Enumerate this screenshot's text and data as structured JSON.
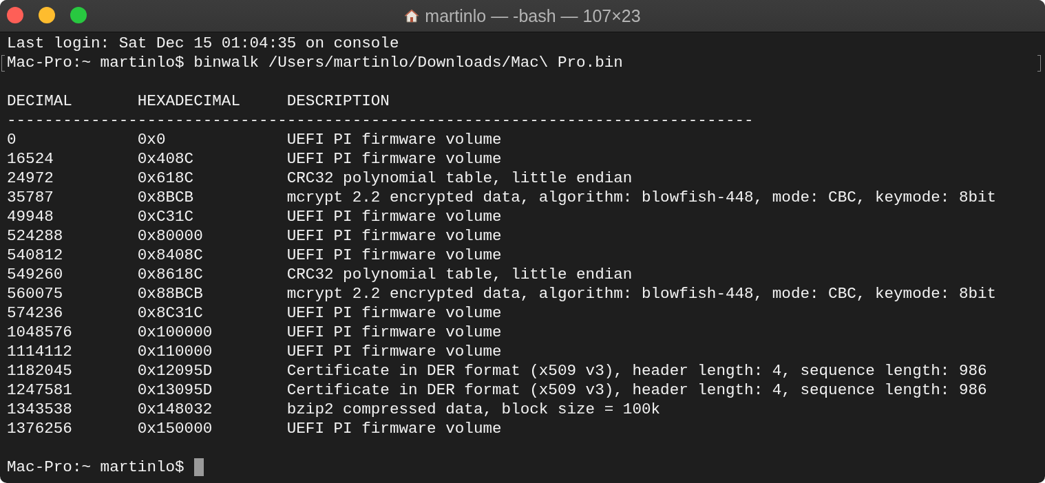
{
  "window": {
    "title": "martinlo — -bash — 107×23"
  },
  "lines": [
    {
      "kind": "text",
      "text": "Last login: Sat Dec 15 01:04:35 on console",
      "marked": false
    },
    {
      "kind": "text",
      "text": "Mac-Pro:~ martinlo$ binwalk /Users/martinlo/Downloads/Mac\\ Pro.bin",
      "marked": true
    },
    {
      "kind": "blank"
    },
    {
      "kind": "row",
      "cells": [
        "DECIMAL",
        "HEXADECIMAL",
        "DESCRIPTION"
      ]
    },
    {
      "kind": "text",
      "text": "--------------------------------------------------------------------------------",
      "marked": false
    },
    {
      "kind": "row",
      "cells": [
        "0",
        "0x0",
        "UEFI PI firmware volume"
      ]
    },
    {
      "kind": "row",
      "cells": [
        "16524",
        "0x408C",
        "UEFI PI firmware volume"
      ]
    },
    {
      "kind": "row",
      "cells": [
        "24972",
        "0x618C",
        "CRC32 polynomial table, little endian"
      ]
    },
    {
      "kind": "row",
      "cells": [
        "35787",
        "0x8BCB",
        "mcrypt 2.2 encrypted data, algorithm: blowfish-448, mode: CBC, keymode: 8bit"
      ]
    },
    {
      "kind": "row",
      "cells": [
        "49948",
        "0xC31C",
        "UEFI PI firmware volume"
      ]
    },
    {
      "kind": "row",
      "cells": [
        "524288",
        "0x80000",
        "UEFI PI firmware volume"
      ]
    },
    {
      "kind": "row",
      "cells": [
        "540812",
        "0x8408C",
        "UEFI PI firmware volume"
      ]
    },
    {
      "kind": "row",
      "cells": [
        "549260",
        "0x8618C",
        "CRC32 polynomial table, little endian"
      ]
    },
    {
      "kind": "row",
      "cells": [
        "560075",
        "0x88BCB",
        "mcrypt 2.2 encrypted data, algorithm: blowfish-448, mode: CBC, keymode: 8bit"
      ]
    },
    {
      "kind": "row",
      "cells": [
        "574236",
        "0x8C31C",
        "UEFI PI firmware volume"
      ]
    },
    {
      "kind": "row",
      "cells": [
        "1048576",
        "0x100000",
        "UEFI PI firmware volume"
      ]
    },
    {
      "kind": "row",
      "cells": [
        "1114112",
        "0x110000",
        "UEFI PI firmware volume"
      ]
    },
    {
      "kind": "row",
      "cells": [
        "1182045",
        "0x12095D",
        "Certificate in DER format (x509 v3), header length: 4, sequence length: 986"
      ]
    },
    {
      "kind": "row",
      "cells": [
        "1247581",
        "0x13095D",
        "Certificate in DER format (x509 v3), header length: 4, sequence length: 986"
      ]
    },
    {
      "kind": "row",
      "cells": [
        "1343538",
        "0x148032",
        "bzip2 compressed data, block size = 100k"
      ]
    },
    {
      "kind": "row",
      "cells": [
        "1376256",
        "0x150000",
        "UEFI PI firmware volume"
      ]
    },
    {
      "kind": "blank"
    },
    {
      "kind": "prompt",
      "text": "Mac-Pro:~ martinlo$"
    }
  ]
}
